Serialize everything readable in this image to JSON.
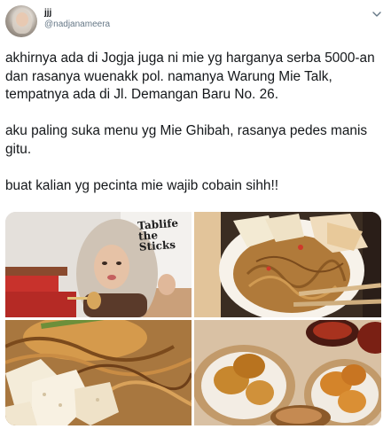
{
  "user": {
    "display_name": "jjj",
    "handle": "@nadjanameera"
  },
  "tweet": {
    "text": "akhirnya ada di Jogja juga ni mie yg harganya serba 5000-an dan rasanya wuenakk pol. namanya Warung Mie Talk, tempatnya ada di Jl. Demangan Baru No. 26.\n\naku paling suka menu yg Mie Ghibah, rasanya pedes manis gitu.\n\nbuat kalian yg pecinta mie wajib cobain sihh!!"
  },
  "media": {
    "photos": [
      {
        "label": "photo-woman-eating-noodles",
        "sign_text": "Tablife the Sticks"
      },
      {
        "label": "photo-noodles-with-crackers-and-chopsticks"
      },
      {
        "label": "photo-noodles-closeup-with-crackers"
      },
      {
        "label": "photo-fried-snacks-in-bowls"
      }
    ]
  },
  "icons": {
    "more": "chevron-down-icon"
  }
}
